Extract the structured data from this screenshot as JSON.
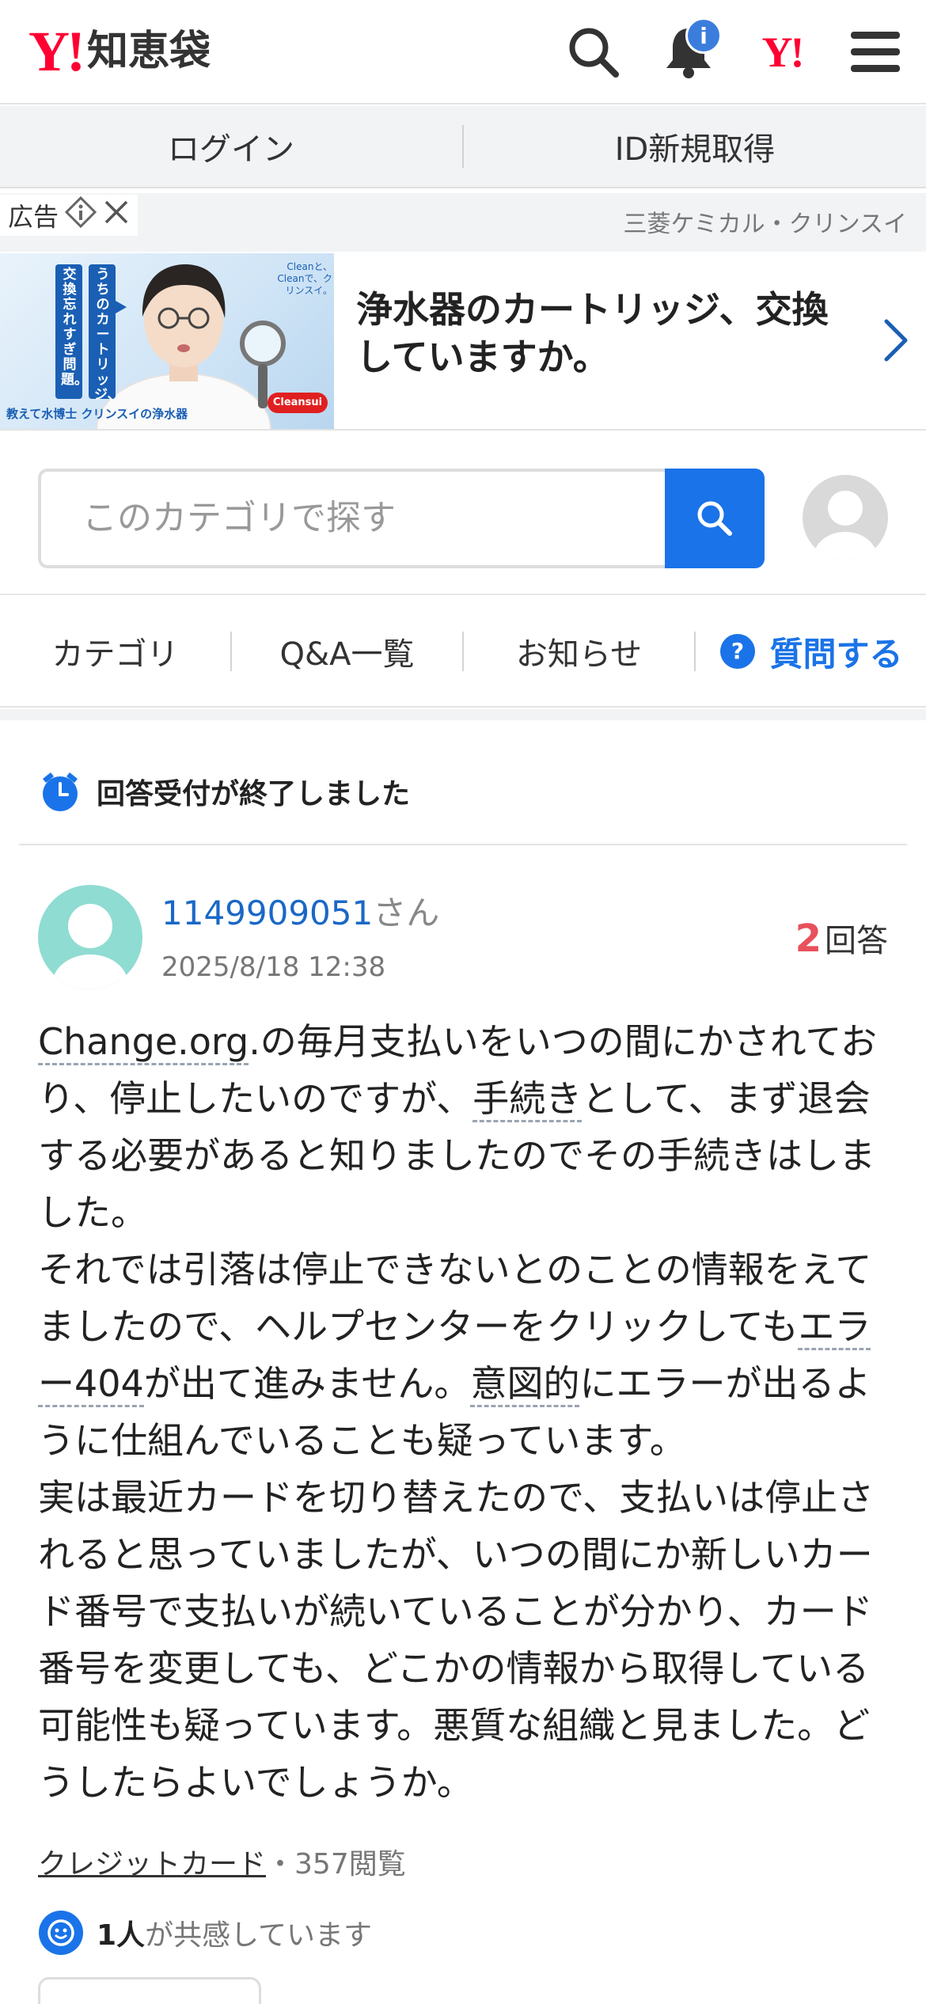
{
  "header": {
    "logo_mark": "Y!",
    "logo_text": "知恵袋",
    "notification_badge": "i",
    "yj_mark": "Y!"
  },
  "login_bar": {
    "login": "ログイン",
    "register": "ID新規取得"
  },
  "ad": {
    "label": "広告",
    "sponsor": "三菱ケミカル・クリンスイ",
    "headline": "浄水器のカートリッジ、交換していますか。",
    "image_caption": "教えて水博士 クリンスイの浄水器",
    "image_vertical_1": "うちのカートリッジ、",
    "image_vertical_2": "交換忘れすぎ問題。",
    "image_slogan": "Cleanと、Cleanで、クリンスイ。",
    "image_brand": "Cleansui"
  },
  "search": {
    "placeholder": "このカテゴリで探す"
  },
  "nav": {
    "category": "カテゴリ",
    "qa_list": "Q&A一覧",
    "notice": "お知らせ",
    "ask": "質問する"
  },
  "status": {
    "closed_text": "回答受付が終了しました"
  },
  "question": {
    "user_id": "1149909051",
    "user_suffix": "さん",
    "date": "2025/8/18 12:38",
    "answer_count": "2",
    "answer_label": "回答",
    "kw_change_org": "Change.org",
    "text_1": ".の毎月支払いをいつの間にかされており、停止したいのですが、",
    "kw_procedure": "手続き",
    "text_2": "として、まず退会する必要があると知りましたのでその手続きはしました。",
    "text_3": "それでは引落は停止できないとのことの情報をえてましたので、ヘルプセンターをクリックしても",
    "kw_error": "エラー404",
    "text_4": "が出て進みません。",
    "kw_intent": "意図的",
    "text_5": "にエラーが出るように仕組んでいることも疑っています。",
    "text_6": "実は最近カードを切り替えたので、支払いは停止されると思っていましたが、いつの間にか新しいカード番号で支払いが続いていることが分かり、カード番号を変更しても、どこかの情報から取得している可能性も疑っています。悪質な組織と見ました。どうしたらよいでしょうか。",
    "category": "クレジットカード",
    "views": "357閲覧",
    "meta_sep": "・",
    "empathy_count": "1人",
    "empathy_text": "が共感しています"
  },
  "colors": {
    "brand_red": "#ff0033",
    "link_blue": "#1a73e8",
    "answer_count_red": "#e8505b",
    "avatar_teal": "#8fdcd2"
  }
}
